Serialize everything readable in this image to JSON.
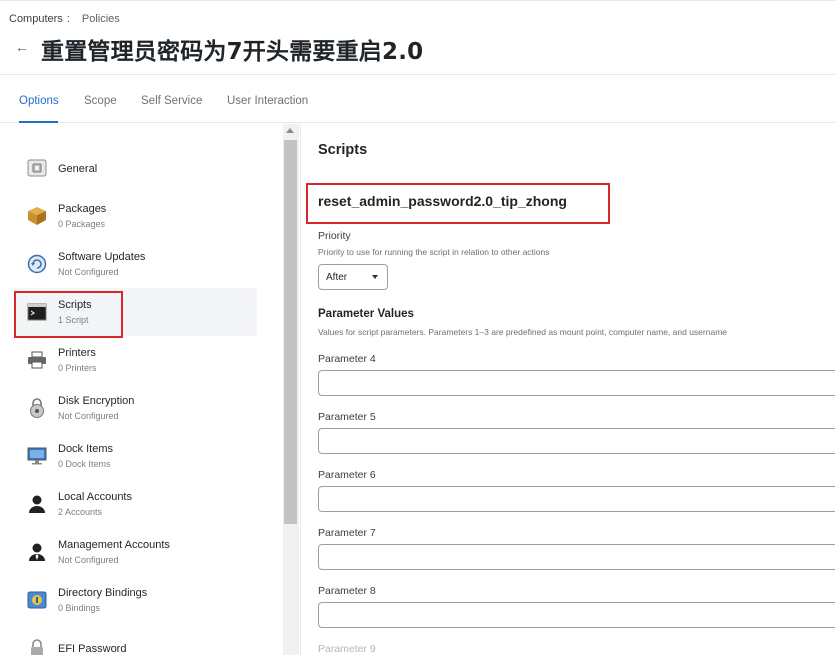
{
  "breadcrumb": {
    "first": "Computers",
    "separator": ":",
    "second": "Policies"
  },
  "header": {
    "back_icon": "←",
    "title": "重置管理员密码为7开头需要重启2.0"
  },
  "tabs": [
    "Options",
    "Scope",
    "Self Service",
    "User Interaction"
  ],
  "active_tab": "Options",
  "sidebar": {
    "items": [
      {
        "label": "General",
        "sub": "",
        "icon": "general-icon"
      },
      {
        "label": "Packages",
        "sub": "0 Packages",
        "icon": "package-icon"
      },
      {
        "label": "Software Updates",
        "sub": "Not Configured",
        "icon": "software-update-icon"
      },
      {
        "label": "Scripts",
        "sub": "1 Script",
        "icon": "terminal-icon"
      },
      {
        "label": "Printers",
        "sub": "0 Printers",
        "icon": "printer-icon"
      },
      {
        "label": "Disk Encryption",
        "sub": "Not Configured",
        "icon": "disk-encryption-icon"
      },
      {
        "label": "Dock Items",
        "sub": "0 Dock Items",
        "icon": "monitor-icon"
      },
      {
        "label": "Local Accounts",
        "sub": "2 Accounts",
        "icon": "user-icon"
      },
      {
        "label": "Management Accounts",
        "sub": "Not Configured",
        "icon": "admin-user-icon"
      },
      {
        "label": "Directory Bindings",
        "sub": "0 Bindings",
        "icon": "directory-icon"
      },
      {
        "label": "EFI Password",
        "sub": "",
        "icon": "lock-icon"
      }
    ],
    "selected": "Scripts"
  },
  "main": {
    "section_title": "Scripts",
    "script_name": "reset_admin_password2.0_tip_zhong",
    "priority_label": "Priority",
    "priority_hint": "Priority to use for running the script in relation to other actions",
    "priority_value": "After",
    "params_heading": "Parameter Values",
    "params_hint": "Values for script parameters. Parameters 1–3 are predefined as mount point, computer name, and username",
    "parameters": [
      {
        "label": "Parameter 4",
        "value": ""
      },
      {
        "label": "Parameter 5",
        "value": ""
      },
      {
        "label": "Parameter 6",
        "value": ""
      },
      {
        "label": "Parameter 7",
        "value": ""
      },
      {
        "label": "Parameter 8",
        "value": ""
      },
      {
        "label": "Parameter 9",
        "value": ""
      }
    ]
  },
  "colors": {
    "accent": "#1f6fd1",
    "highlight": "#d8262d"
  }
}
